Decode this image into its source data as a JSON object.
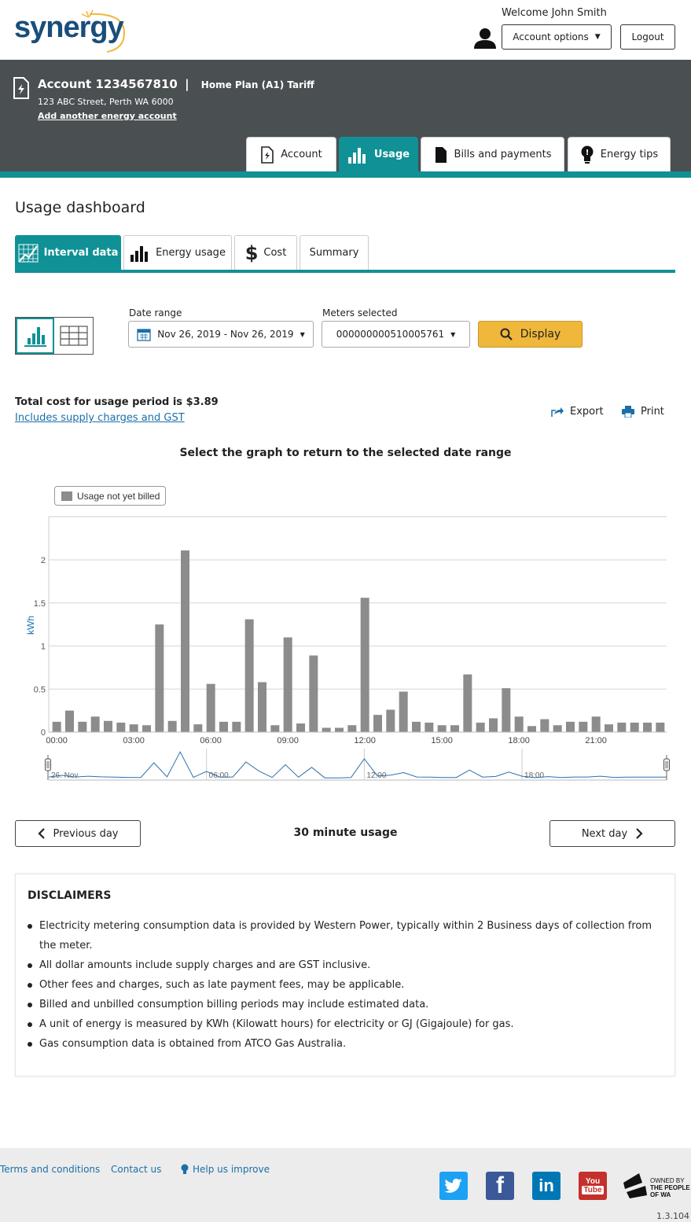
{
  "header": {
    "logo_text": "synergy",
    "welcome": "Welcome John Smith",
    "account_options_label": "Account options",
    "logout_label": "Logout"
  },
  "account": {
    "title": "Account 1234567810",
    "plan": "Home Plan (A1) Tariff",
    "address": "123 ABC Street, Perth WA 6000",
    "add_link": "Add another energy account"
  },
  "main_tabs": [
    {
      "label": "Account"
    },
    {
      "label": "Usage"
    },
    {
      "label": "Bills and payments"
    },
    {
      "label": "Energy tips"
    }
  ],
  "page_title": "Usage dashboard",
  "sub_tabs": [
    {
      "label": "Interval data"
    },
    {
      "label": "Energy usage"
    },
    {
      "label": "Cost"
    },
    {
      "label": "Summary"
    }
  ],
  "filters": {
    "date_range_label": "Date range",
    "date_range_value": "Nov 26, 2019 - Nov 26, 2019",
    "meters_label": "Meters selected",
    "meters_value": "000000000510005761",
    "display_label": "Display"
  },
  "summary": {
    "total_text": "Total cost for usage period is $3.89",
    "includes_link": "Includes supply charges and GST",
    "export_label": "Export",
    "print_label": "Print"
  },
  "graph_title": "Select the graph to return to the selected date range",
  "chart_data": {
    "type": "bar",
    "ylabel": "kWh",
    "ylim": [
      0,
      2.5
    ],
    "yticks": [
      "0",
      "0.5",
      "1",
      "1.5",
      "2"
    ],
    "xticks": [
      "00:00",
      "03:00",
      "06:00",
      "09:00",
      "12:00",
      "15:00",
      "18:00",
      "21:00"
    ],
    "legend": [
      "Usage not yet billed"
    ],
    "series": [
      {
        "name": "Usage not yet billed",
        "color": "#8c8c8c",
        "values": [
          0.12,
          0.25,
          0.12,
          0.18,
          0.13,
          0.11,
          0.09,
          0.08,
          1.25,
          0.13,
          2.11,
          0.09,
          0.56,
          0.12,
          0.12,
          1.31,
          0.58,
          0.08,
          1.1,
          0.1,
          0.89,
          0.05,
          0.05,
          0.08,
          1.56,
          0.2,
          0.26,
          0.47,
          0.12,
          0.11,
          0.08,
          0.08,
          0.67,
          0.11,
          0.16,
          0.51,
          0.18,
          0.07,
          0.15,
          0.08,
          0.12,
          0.12,
          0.18,
          0.09,
          0.11,
          0.11,
          0.11,
          0.11
        ]
      }
    ],
    "navigator_labels": [
      "26. Nov",
      "06:00",
      "12:00",
      "18:00"
    ]
  },
  "navigation": {
    "previous_label": "Previous day",
    "interval_label": "30 minute usage",
    "next_label": "Next day"
  },
  "disclaimers": {
    "title": "DISCLAIMERS",
    "items": [
      "Electricity metering consumption data is provided by Western Power, typically within 2 Business days of collection from the meter.",
      "All dollar amounts include supply charges and are GST inclusive.",
      "Other fees and charges, such as late payment fees, may be applicable.",
      "Billed and unbilled consumption billing periods may include estimated data.",
      "A unit of energy is measured by KWh (Kilowatt hours) for electricity or GJ (Gigajoule) for gas.",
      "Gas consumption data is obtained from ATCO Gas Australia."
    ]
  },
  "footer": {
    "terms": "Terms and conditions",
    "contact": "Contact us",
    "help": "Help us improve",
    "owned_line1": "OWNED BY",
    "owned_line2": "THE PEOPLE",
    "owned_line3": "OF WA",
    "youtube_top": "You",
    "youtube_bottom": "Tube",
    "version": "1.3.104"
  },
  "colors": {
    "teal": "#0f9196",
    "band": "#4a4f52",
    "display_button": "#f0b83a",
    "bar": "#8c8c8c",
    "navigator_line": "#2f6fb0"
  }
}
